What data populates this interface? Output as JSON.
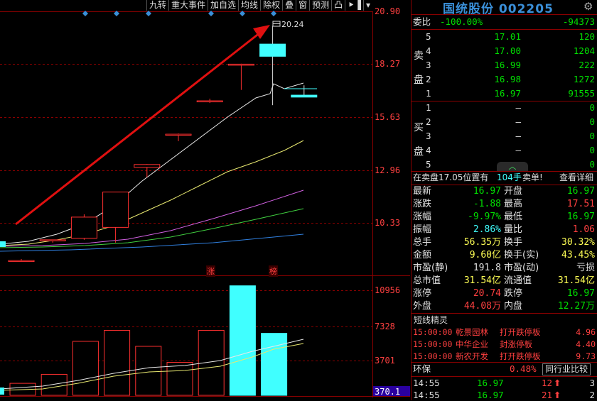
{
  "toolbar": {
    "items": [
      "九转",
      "重大事件",
      "加自选",
      "均线",
      "除权",
      "叠",
      "窗",
      "预测",
      "凸"
    ]
  },
  "chart": {
    "price_axis": [
      "20.90",
      "18.27",
      "15.63",
      "12.96",
      "10.33"
    ],
    "volume_axis": [
      "10956",
      "7328",
      "3701",
      "370.1"
    ],
    "high_label": "20.24",
    "limit_markers": [
      "涨",
      "榜"
    ]
  },
  "chart_data": [
    {
      "type": "candlestick",
      "ylim": [
        8.8,
        20.9
      ],
      "candles": [
        {
          "o": 9.48,
          "c": 9.48,
          "h": 9.55,
          "l": 9.42,
          "dir": "up"
        },
        {
          "o": 10.43,
          "c": 10.43,
          "h": 10.43,
          "l": 10.3,
          "dir": "up"
        },
        {
          "o": 10.5,
          "c": 11.47,
          "h": 11.6,
          "l": 10.43,
          "dir": "up"
        },
        {
          "o": 11.0,
          "c": 12.62,
          "h": 12.62,
          "l": 10.3,
          "dir": "up"
        },
        {
          "o": 13.75,
          "c": 13.88,
          "h": 13.9,
          "l": 13.3,
          "dir": "up"
        },
        {
          "o": 15.27,
          "c": 15.27,
          "h": 15.3,
          "l": 14.95,
          "dir": "up"
        },
        {
          "o": 16.8,
          "c": 16.8,
          "h": 16.9,
          "l": 16.7,
          "dir": "up"
        },
        {
          "o": 18.48,
          "c": 18.48,
          "h": 18.5,
          "l": 17.3,
          "dir": "up"
        },
        {
          "o": 19.4,
          "c": 18.84,
          "h": 20.24,
          "l": 16.6,
          "dir": "down"
        },
        {
          "o": 17.06,
          "c": 16.97,
          "h": 17.51,
          "l": 16.97,
          "dir": "down"
        }
      ]
    },
    {
      "type": "bar",
      "ylim": [
        0,
        11500
      ],
      "values": [
        1200,
        2100,
        5400,
        6500,
        4900,
        3300,
        6500,
        10956,
        6200
      ],
      "dir": [
        "up",
        "up",
        "up",
        "up",
        "up",
        "up",
        "up",
        "down",
        "down"
      ]
    }
  ],
  "header": {
    "name": "国统股份",
    "code": "002205"
  },
  "weibi": {
    "label": "委比",
    "pct": "-100.00%",
    "diff": "-94373"
  },
  "sell": {
    "label": "卖盘",
    "rows": [
      {
        "n": "5",
        "p": "17.01",
        "v": "120"
      },
      {
        "n": "4",
        "p": "17.00",
        "v": "1204"
      },
      {
        "n": "3",
        "p": "16.99",
        "v": "222"
      },
      {
        "n": "2",
        "p": "16.98",
        "v": "1272"
      },
      {
        "n": "1",
        "p": "16.97",
        "v": "91555"
      }
    ]
  },
  "buy": {
    "label": "买盘",
    "rows": [
      {
        "n": "1",
        "p": "–",
        "v": "0"
      },
      {
        "n": "2",
        "p": "–",
        "v": "0"
      },
      {
        "n": "3",
        "p": "–",
        "v": "0"
      },
      {
        "n": "4",
        "p": "–",
        "v": "0"
      },
      {
        "n": "5",
        "p": "–",
        "v": "0"
      }
    ]
  },
  "order_notice": {
    "text": "在卖盘17.05位置有",
    "vol": "104手",
    "tag": "卖单!",
    "link": "查看详细"
  },
  "quote": [
    [
      "最新",
      "16.97",
      "green",
      "开盘",
      "16.97",
      "green"
    ],
    [
      "涨跌",
      "-1.88",
      "green",
      "最高",
      "17.51",
      "red"
    ],
    [
      "涨幅",
      "-9.97%",
      "green",
      "最低",
      "16.97",
      "green"
    ],
    [
      "振幅",
      "2.86%",
      "cyan",
      "量比",
      "1.06",
      "red"
    ],
    [
      "总手",
      "56.35万",
      "yel",
      "换手",
      "30.32%",
      "yel"
    ],
    [
      "金额",
      "9.60亿",
      "yel",
      "换手(实)",
      "43.45%",
      "yel"
    ],
    [
      "市盈(静)",
      "191.8",
      "white",
      "市盈(动)",
      "亏损",
      "white"
    ],
    [
      "总市值",
      "31.54亿",
      "yel",
      "流通值",
      "31.54亿",
      "yel"
    ],
    [
      "涨停",
      "20.74",
      "red",
      "跌停",
      "16.97",
      "green"
    ],
    [
      "外盘",
      "44.08万",
      "red",
      "内盘",
      "12.27万",
      "green"
    ]
  ],
  "news": {
    "title": "短线精灵",
    "rows": [
      {
        "t": "15:00:00",
        "name": "乾景园林",
        "ev": "打开跌停板",
        "v": "4.96"
      },
      {
        "t": "15:00:00",
        "name": "中华企业",
        "ev": "封涨停板",
        "v": "4.40"
      },
      {
        "t": "15:00:00",
        "name": "新农开发",
        "ev": "打开跌停板",
        "v": "9.73"
      }
    ]
  },
  "industry": {
    "name": "环保",
    "pct": "0.48%",
    "btn": "同行业比较"
  },
  "ticks": [
    {
      "t": "14:55",
      "p": "16.97",
      "v": "12",
      "n": "3"
    },
    {
      "t": "14:55",
      "p": "16.97",
      "v": "21",
      "n": "2"
    }
  ],
  "colors": {
    "up": "#ff3030",
    "down": "#40ffff",
    "bg": "#000000",
    "grid": "#8a0000",
    "arrow": "#e01010"
  }
}
